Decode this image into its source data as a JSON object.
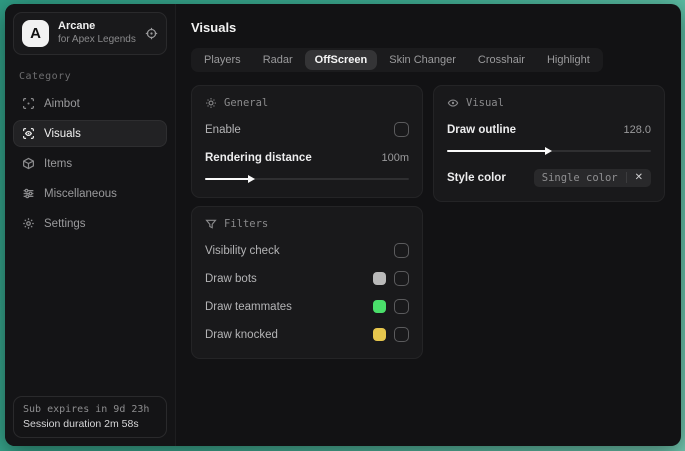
{
  "app": {
    "logo_letter": "A",
    "name": "Arcane",
    "subtitle": "for Apex Legends"
  },
  "sidebar": {
    "category_label": "Category",
    "items": [
      {
        "label": "Aimbot",
        "icon": "crosshair-scan-icon"
      },
      {
        "label": "Visuals",
        "icon": "eye-scan-icon"
      },
      {
        "label": "Items",
        "icon": "cube-icon"
      },
      {
        "label": "Miscellaneous",
        "icon": "sliders-icon"
      },
      {
        "label": "Settings",
        "icon": "gear-icon"
      }
    ],
    "status": {
      "sub_expires": "Sub expires in 9d 23h",
      "session_duration": "Session duration 2m 58s"
    }
  },
  "header": {
    "title": "Visuals"
  },
  "tabs": [
    {
      "label": "Players"
    },
    {
      "label": "Radar"
    },
    {
      "label": "OffScreen"
    },
    {
      "label": "Skin Changer"
    },
    {
      "label": "Crosshair"
    },
    {
      "label": "Highlight"
    }
  ],
  "active_tab": "OffScreen",
  "panels": {
    "general": {
      "title": "General",
      "enable_label": "Enable",
      "enable_checked": false,
      "rendering_distance_label": "Rendering distance",
      "rendering_distance_value": "100m",
      "rendering_distance_percent": 22
    },
    "filters": {
      "title": "Filters",
      "rows": [
        {
          "label": "Visibility check",
          "swatch": null,
          "checked": false
        },
        {
          "label": "Draw bots",
          "swatch": "#b9b9b9",
          "checked": false
        },
        {
          "label": "Draw teammates",
          "swatch": "#4ade6a",
          "checked": false
        },
        {
          "label": "Draw knocked",
          "swatch": "#e6c64d",
          "checked": false
        }
      ]
    },
    "visual": {
      "title": "Visual",
      "draw_outline_label": "Draw outline",
      "draw_outline_value": "128.0",
      "draw_outline_percent": 49,
      "style_color_label": "Style color",
      "style_color_value": "Single color",
      "clear_glyph": "✕"
    }
  },
  "colors": {
    "desktop_teal": "#3daa90",
    "window_bg": "#121214",
    "panel_bg": "#19191b",
    "accent_text": "#f2f2f2",
    "muted_text": "#9a9a9c",
    "swatch_gray": "#b9b9b9",
    "swatch_green": "#4ade6a",
    "swatch_yellow": "#e6c64d"
  }
}
